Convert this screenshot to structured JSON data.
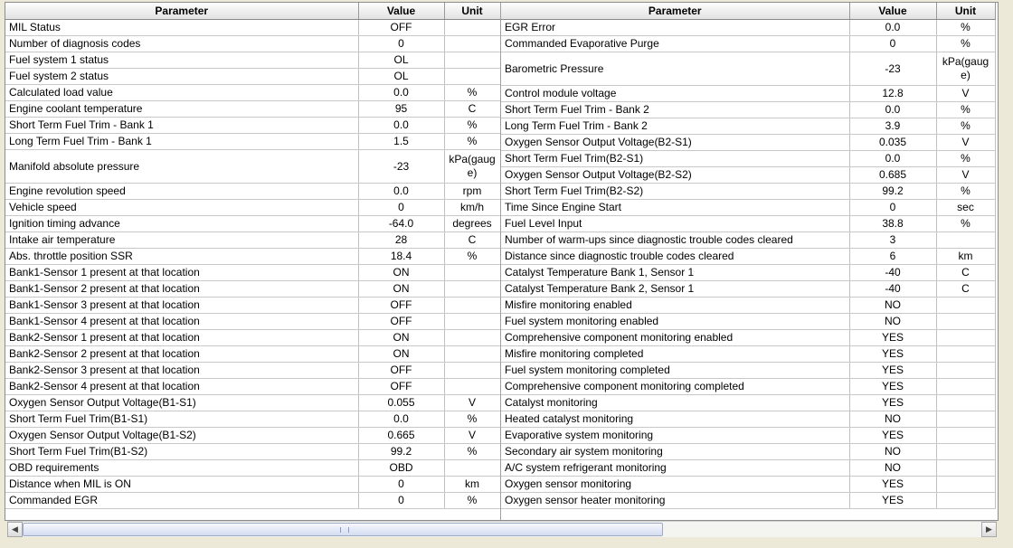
{
  "headers": {
    "parameter": "Parameter",
    "value": "Value",
    "unit": "Unit"
  },
  "left_rows": [
    {
      "p": "MIL Status",
      "v": "OFF",
      "u": ""
    },
    {
      "p": "Number of diagnosis codes",
      "v": "0",
      "u": ""
    },
    {
      "p": "Fuel system 1 status",
      "v": "OL",
      "u": ""
    },
    {
      "p": "Fuel system 2 status",
      "v": "OL",
      "u": ""
    },
    {
      "p": "Calculated load value",
      "v": "0.0",
      "u": "%"
    },
    {
      "p": "Engine coolant temperature",
      "v": "95",
      "u": "C"
    },
    {
      "p": "Short Term Fuel Trim - Bank 1",
      "v": "0.0",
      "u": "%"
    },
    {
      "p": "Long Term Fuel Trim - Bank 1",
      "v": "1.5",
      "u": "%"
    },
    {
      "p": "Manifold absolute pressure",
      "v": "-23",
      "u": "kPa(gauge)",
      "tall": true
    },
    {
      "p": "Engine revolution speed",
      "v": "0.0",
      "u": "rpm"
    },
    {
      "p": "Vehicle speed",
      "v": "0",
      "u": "km/h"
    },
    {
      "p": "Ignition timing advance",
      "v": "-64.0",
      "u": "degrees"
    },
    {
      "p": "Intake air temperature",
      "v": "28",
      "u": "C"
    },
    {
      "p": "Abs. throttle position SSR",
      "v": "18.4",
      "u": "%"
    },
    {
      "p": "Bank1-Sensor 1 present at that location",
      "v": "ON",
      "u": ""
    },
    {
      "p": "Bank1-Sensor 2 present at that location",
      "v": "ON",
      "u": ""
    },
    {
      "p": "Bank1-Sensor 3 present at that location",
      "v": "OFF",
      "u": ""
    },
    {
      "p": "Bank1-Sensor 4 present at that location",
      "v": "OFF",
      "u": ""
    },
    {
      "p": "Bank2-Sensor 1 present at that location",
      "v": "ON",
      "u": ""
    },
    {
      "p": "Bank2-Sensor 2 present at that location",
      "v": "ON",
      "u": ""
    },
    {
      "p": "Bank2-Sensor 3 present at that location",
      "v": "OFF",
      "u": ""
    },
    {
      "p": "Bank2-Sensor 4 present at that location",
      "v": "OFF",
      "u": ""
    },
    {
      "p": "Oxygen Sensor Output Voltage(B1-S1)",
      "v": "0.055",
      "u": "V"
    },
    {
      "p": "Short Term Fuel Trim(B1-S1)",
      "v": "0.0",
      "u": "%"
    },
    {
      "p": "Oxygen Sensor Output Voltage(B1-S2)",
      "v": "0.665",
      "u": "V"
    },
    {
      "p": "Short Term Fuel Trim(B1-S2)",
      "v": "99.2",
      "u": "%"
    },
    {
      "p": "OBD requirements",
      "v": "OBD",
      "u": ""
    },
    {
      "p": "Distance when MIL is ON",
      "v": "0",
      "u": "km"
    },
    {
      "p": "Commanded EGR",
      "v": "0",
      "u": "%"
    }
  ],
  "right_rows": [
    {
      "p": "EGR Error",
      "v": "0.0",
      "u": "%"
    },
    {
      "p": "Commanded Evaporative Purge",
      "v": "0",
      "u": "%"
    },
    {
      "p": "Barometric Pressure",
      "v": "-23",
      "u": "kPa(gauge)",
      "tall": true
    },
    {
      "p": "Control module voltage",
      "v": "12.8",
      "u": "V"
    },
    {
      "p": "Short Term Fuel Trim - Bank 2",
      "v": "0.0",
      "u": "%"
    },
    {
      "p": "Long Term Fuel Trim - Bank 2",
      "v": "3.9",
      "u": "%"
    },
    {
      "p": "Oxygen Sensor Output Voltage(B2-S1)",
      "v": "0.035",
      "u": "V"
    },
    {
      "p": "Short Term Fuel Trim(B2-S1)",
      "v": "0.0",
      "u": "%"
    },
    {
      "p": "Oxygen Sensor Output Voltage(B2-S2)",
      "v": "0.685",
      "u": "V"
    },
    {
      "p": "Short Term Fuel Trim(B2-S2)",
      "v": "99.2",
      "u": "%"
    },
    {
      "p": "Time Since Engine Start",
      "v": "0",
      "u": "sec"
    },
    {
      "p": "Fuel Level Input",
      "v": "38.8",
      "u": "%"
    },
    {
      "p": "Number of warm-ups since diagnostic trouble codes cleared",
      "v": "3",
      "u": ""
    },
    {
      "p": "Distance since diagnostic trouble codes cleared",
      "v": "6",
      "u": "km"
    },
    {
      "p": "Catalyst Temperature Bank 1, Sensor 1",
      "v": "-40",
      "u": "C"
    },
    {
      "p": "Catalyst Temperature Bank 2, Sensor 1",
      "v": "-40",
      "u": "C"
    },
    {
      "p": "Misfire monitoring enabled",
      "v": "NO",
      "u": ""
    },
    {
      "p": "Fuel system monitoring enabled",
      "v": "NO",
      "u": ""
    },
    {
      "p": "Comprehensive component monitoring enabled",
      "v": "YES",
      "u": ""
    },
    {
      "p": "Misfire monitoring completed",
      "v": "YES",
      "u": ""
    },
    {
      "p": "Fuel system monitoring completed",
      "v": "YES",
      "u": ""
    },
    {
      "p": "Comprehensive component monitoring completed",
      "v": "YES",
      "u": ""
    },
    {
      "p": "Catalyst monitoring",
      "v": "YES",
      "u": ""
    },
    {
      "p": "Heated catalyst monitoring",
      "v": "NO",
      "u": ""
    },
    {
      "p": "Evaporative system monitoring",
      "v": "YES",
      "u": ""
    },
    {
      "p": "Secondary air system monitoring",
      "v": "NO",
      "u": ""
    },
    {
      "p": "A/C system refrigerant monitoring",
      "v": "NO",
      "u": ""
    },
    {
      "p": "Oxygen sensor monitoring",
      "v": "YES",
      "u": ""
    },
    {
      "p": "Oxygen sensor heater monitoring",
      "v": "YES",
      "u": ""
    }
  ],
  "scrollbar": {
    "left_arrow_icon": "chevron-left-icon",
    "right_arrow_icon": "chevron-right-icon",
    "left_arrow_glyph": "◀",
    "right_arrow_glyph": "▶",
    "thumb_position_fraction": 0.0,
    "thumb_size_fraction": 0.66
  },
  "colors": {
    "window_bg": "#ece9d8",
    "header_bg": "#e3e3e3",
    "grid_line": "#c0c0c0",
    "scroll_thumb": "#d3dcf0"
  }
}
